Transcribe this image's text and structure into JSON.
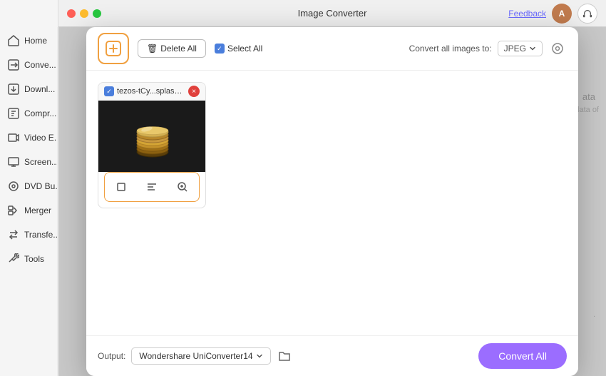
{
  "window": {
    "title": "Image Converter",
    "feedback_label": "Feedback"
  },
  "titlebar": {
    "avatar_initial": "A"
  },
  "sidebar": {
    "items": [
      {
        "id": "home",
        "label": "Home",
        "icon": "home"
      },
      {
        "id": "convert",
        "label": "Conve...",
        "icon": "convert"
      },
      {
        "id": "download",
        "label": "Downl...",
        "icon": "download"
      },
      {
        "id": "compress",
        "label": "Compr...",
        "icon": "compress"
      },
      {
        "id": "video-edit",
        "label": "Video E...",
        "icon": "video"
      },
      {
        "id": "screen",
        "label": "Screen...",
        "icon": "screen"
      },
      {
        "id": "dvd-burn",
        "label": "DVD Bu...",
        "icon": "dvd"
      },
      {
        "id": "merger",
        "label": "Merger",
        "icon": "merge"
      },
      {
        "id": "transfer",
        "label": "Transfe...",
        "icon": "transfer"
      },
      {
        "id": "tools",
        "label": "Tools",
        "icon": "tools"
      }
    ]
  },
  "toolbar": {
    "delete_all_label": "Delete All",
    "select_all_label": "Select All",
    "convert_format_label": "Convert all images to:",
    "format_value": "JPEG"
  },
  "image_card": {
    "filename": "tezos-tCy...splash.jpg",
    "close_symbol": "×"
  },
  "action_icons": {
    "crop_label": "crop",
    "list_label": "list",
    "zoom_label": "zoom"
  },
  "bottom": {
    "output_label": "Output:",
    "output_path": "Wondershare UniConverter14",
    "convert_all_label": "Convert All"
  }
}
